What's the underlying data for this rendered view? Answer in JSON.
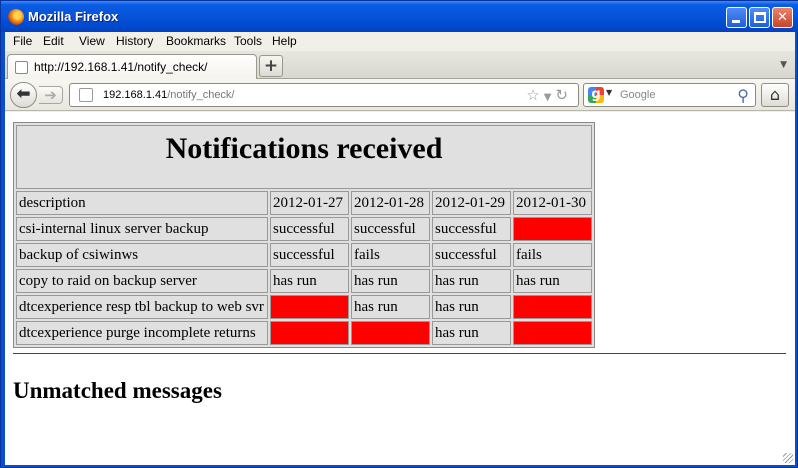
{
  "window": {
    "title": "Mozilla Firefox"
  },
  "menu": [
    {
      "label": "File"
    },
    {
      "label": "Edit"
    },
    {
      "label": "View"
    },
    {
      "label": "History"
    },
    {
      "label": "Bookmarks"
    },
    {
      "label": "Tools"
    },
    {
      "label": "Help"
    }
  ],
  "tab": {
    "label": "http://192.168.1.41/notify_check/",
    "new_tab_label": "+"
  },
  "url": {
    "host": "192.168.1.41",
    "path": "/notify_check/"
  },
  "search": {
    "placeholder": "Google"
  },
  "page": {
    "heading": "Notifications received",
    "columns": [
      "description",
      "2012-01-27",
      "2012-01-28",
      "2012-01-29",
      "2012-01-30"
    ],
    "rows": [
      {
        "description": "csi-internal linux server backup",
        "cells": [
          {
            "text": "successful",
            "status": "ok"
          },
          {
            "text": "successful",
            "status": "ok"
          },
          {
            "text": "successful",
            "status": "ok"
          },
          {
            "text": "",
            "status": "missing"
          }
        ]
      },
      {
        "description": "backup of csiwinws",
        "cells": [
          {
            "text": "successful",
            "status": "ok"
          },
          {
            "text": "fails",
            "status": "ok"
          },
          {
            "text": "successful",
            "status": "ok"
          },
          {
            "text": "fails",
            "status": "ok"
          }
        ]
      },
      {
        "description": "copy to raid on backup server",
        "cells": [
          {
            "text": "has run",
            "status": "ok"
          },
          {
            "text": "has run",
            "status": "ok"
          },
          {
            "text": "has run",
            "status": "ok"
          },
          {
            "text": "has run",
            "status": "ok"
          }
        ]
      },
      {
        "description": "dtcexperience resp tbl backup to web svr",
        "cells": [
          {
            "text": "",
            "status": "missing"
          },
          {
            "text": "has run",
            "status": "ok"
          },
          {
            "text": "has run",
            "status": "ok"
          },
          {
            "text": "",
            "status": "missing"
          }
        ]
      },
      {
        "description": "dtcexperience purge incomplete returns",
        "cells": [
          {
            "text": "",
            "status": "missing"
          },
          {
            "text": "",
            "status": "missing"
          },
          {
            "text": "has run",
            "status": "ok"
          },
          {
            "text": "",
            "status": "missing"
          }
        ]
      }
    ],
    "unmatched_heading": "Unmatched messages"
  },
  "colors": {
    "missing": "#ff0000",
    "cell_bg": "#e0e0e0",
    "titlebar": "#0654d8"
  }
}
